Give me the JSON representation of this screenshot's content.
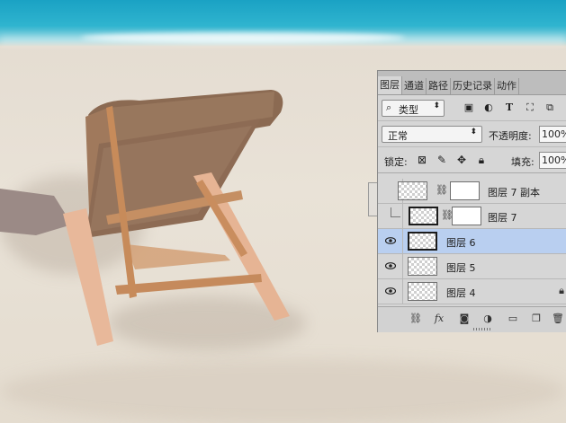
{
  "panel": {
    "tabs": [
      {
        "label": "图层",
        "active": true
      },
      {
        "label": "通道",
        "active": false
      },
      {
        "label": "路径",
        "active": false
      },
      {
        "label": "历史记录",
        "active": false
      },
      {
        "label": "动作",
        "active": false
      }
    ],
    "filter": {
      "kind_label": "类型",
      "icons": [
        "image-filter-icon",
        "adjustment-filter-icon",
        "type-filter-icon",
        "shape-filter-icon",
        "smart-object-filter-icon"
      ]
    },
    "blend": {
      "mode": "正常",
      "opacity_label": "不透明度:",
      "opacity_value": "100%"
    },
    "lock": {
      "label": "锁定:",
      "icons": [
        "lock-transparent-pixels-icon",
        "lock-image-pixels-icon",
        "lock-position-icon",
        "lock-all-icon"
      ],
      "fill_label": "填充:",
      "fill_value": "100%"
    },
    "layers": [
      {
        "name": "图层 7 副本",
        "visible": false,
        "has_mask": true,
        "selected": false,
        "locked": false,
        "clipped": true
      },
      {
        "name": "图层 7",
        "visible": false,
        "has_mask": true,
        "selected": false,
        "locked": false,
        "clipped": true
      },
      {
        "name": "图层 6",
        "visible": true,
        "has_mask": false,
        "selected": true,
        "locked": false,
        "clipped": false
      },
      {
        "name": "图层 5",
        "visible": true,
        "has_mask": false,
        "selected": false,
        "locked": false,
        "clipped": false
      },
      {
        "name": "图层 4",
        "visible": true,
        "has_mask": false,
        "selected": false,
        "locked": true,
        "clipped": false
      }
    ],
    "bottom_icons": [
      "link-layers-icon",
      "fx-icon",
      "add-mask-icon",
      "adjustment-layer-icon",
      "new-group-icon",
      "new-layer-icon",
      "delete-layer-icon"
    ],
    "fx_label": "fx",
    "colors": {
      "panel_bg": "#d6d6d6",
      "selected_row": "#b9cff0",
      "tab_bar": "#bdbdbd"
    }
  }
}
